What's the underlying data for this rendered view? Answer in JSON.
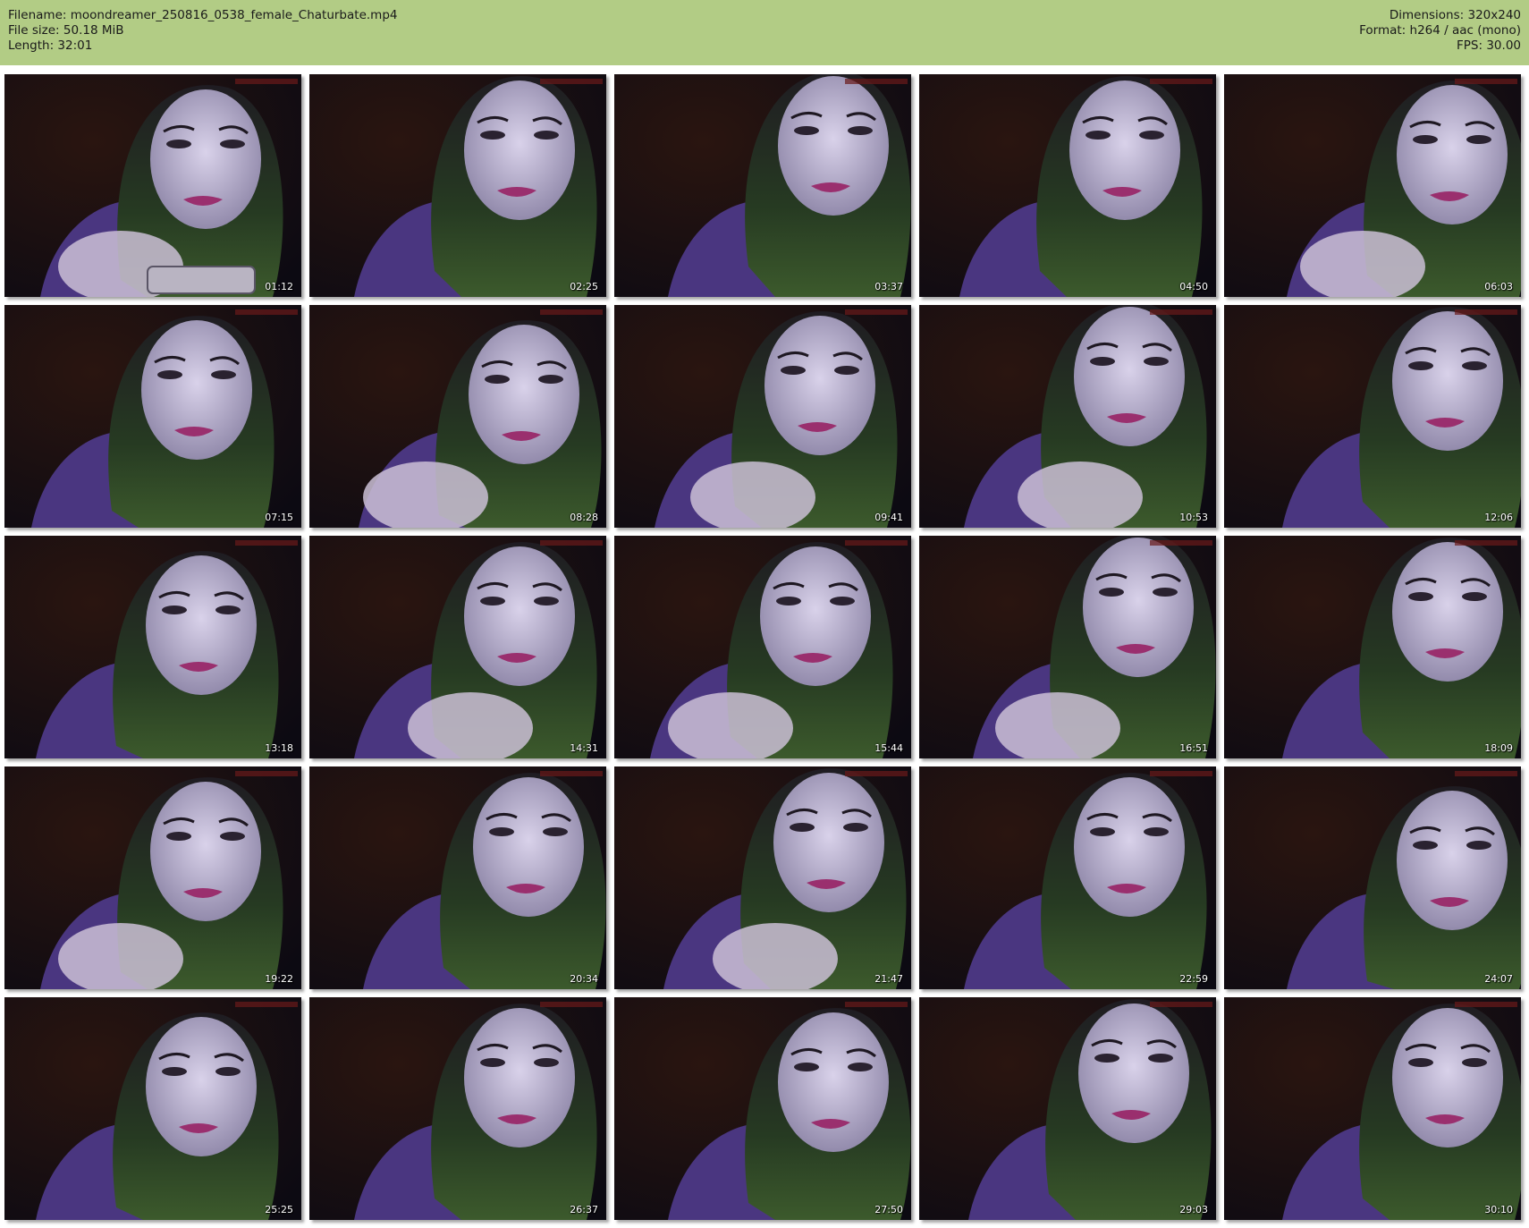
{
  "header": {
    "filename": "Filename: moondreamer_250816_0538_female_Chaturbate.mp4",
    "filesize": "File size: 50.18 MiB",
    "length": "Length: 32:01",
    "dimensions": "Dimensions: 320x240",
    "format": "Format: h264 / aac (mono)",
    "fps": "FPS: 30.00",
    "background_color": "#b2cc85"
  },
  "thumbnails": [
    {
      "time": "01:12",
      "icon": "phone-in-hand"
    },
    {
      "time": "02:25"
    },
    {
      "time": "03:37"
    },
    {
      "time": "04:50"
    },
    {
      "time": "06:03",
      "icon": "hand"
    },
    {
      "time": "07:15"
    },
    {
      "time": "08:28",
      "icon": "hand"
    },
    {
      "time": "09:41",
      "icon": "hand"
    },
    {
      "time": "10:53",
      "icon": "hand"
    },
    {
      "time": "12:06"
    },
    {
      "time": "13:18"
    },
    {
      "time": "14:31",
      "icon": "hand"
    },
    {
      "time": "15:44",
      "icon": "hand"
    },
    {
      "time": "16:51",
      "icon": "hand"
    },
    {
      "time": "18:09"
    },
    {
      "time": "19:22",
      "icon": "hand"
    },
    {
      "time": "20:34"
    },
    {
      "time": "21:47",
      "icon": "hand"
    },
    {
      "time": "22:59"
    },
    {
      "time": "24:07"
    },
    {
      "time": "25:25"
    },
    {
      "time": "26:37"
    },
    {
      "time": "27:50"
    },
    {
      "time": "29:03"
    },
    {
      "time": "30:10"
    }
  ]
}
